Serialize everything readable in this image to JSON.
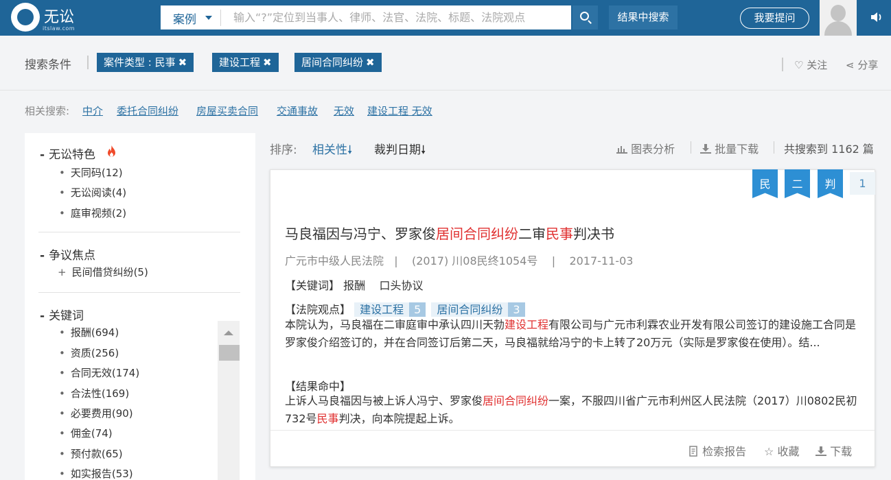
{
  "header": {
    "logo_text": "无讼",
    "logo_sub": "itslaw.com",
    "search_type": "案例",
    "search_placeholder": "输入“?”定位到当事人、律师、法官、法院、标题、法院观点",
    "search_in_results": "结果中搜索",
    "ask_button": "我要提问"
  },
  "filters": {
    "label": "搜索条件",
    "chips": [
      "案件类型 : 民事",
      "建设工程",
      "居间合同纠纷"
    ],
    "close_glyph": "✖",
    "follow": "关注",
    "share": "分享"
  },
  "related": {
    "label": "相关搜索:",
    "links": [
      "中介",
      "委托合同纠纷",
      "房屋买卖合同",
      "交通事故",
      "无效",
      "建设工程 无效"
    ]
  },
  "sidebar": {
    "sections": [
      {
        "title": "无讼特色",
        "items": [
          "天同码(12)",
          "无讼阅读(4)",
          "庭审视频(2)"
        ]
      },
      {
        "title": "争议焦点",
        "items": [
          "民间借贷纠纷(5)"
        ]
      },
      {
        "title": "关键词",
        "items": [
          "报酬(694)",
          "资质(256)",
          "合同无效(174)",
          "合法性(169)",
          "必要费用(90)",
          "佣金(74)",
          "预付款(65)",
          "如实报告(53)"
        ]
      }
    ]
  },
  "sort": {
    "label": "排序:",
    "relevance": "相关性",
    "date": "裁判日期",
    "chart": "图表分析",
    "bulk_download": "批量下载",
    "total": "共搜索到 1162 篇"
  },
  "result": {
    "ribbons": [
      "民",
      "二",
      "判"
    ],
    "index": "1",
    "title_parts": [
      "马良福因与冯宁、罗家俊",
      "居间合同纠纷",
      "二审",
      "民事",
      "判决书"
    ],
    "meta": "广元市中级人民法院   |    (2017) 川08民终1054号    |    2017-11-03",
    "keywords_label": "【关键词】",
    "keywords": "报酬    口头协议",
    "court_view_label": "【法院观点】",
    "tags": [
      {
        "name": "建设工程",
        "count": "5"
      },
      {
        "name": "居间合同纠纷",
        "count": "3"
      }
    ],
    "court_view_text_1": "本院认为，马良福在二审庭审中承认四川天勃",
    "court_view_hl": "建设工程",
    "court_view_text_2": "有限公司与广元市利霖农业开发有限公司签订的建设施工合同是罗家俊介绍签订的，并在合同签订后第二天，马良福就给冯宁的卡上转了20万元（实际是罗家俊在使用）。结...",
    "hit_label": "【结果命中】",
    "hit_1": "上诉人马良福因与被上诉人冯宁、罗家俊",
    "hit_hl_1": "居间合同纠纷",
    "hit_2": "一案，不服四川省广元市利州区人民法院（2017）川0802民初732号",
    "hit_hl_2": "民事",
    "hit_3": "判决，向本院提起上诉。",
    "footer": [
      "检索报告",
      "收藏",
      "下载"
    ]
  }
}
